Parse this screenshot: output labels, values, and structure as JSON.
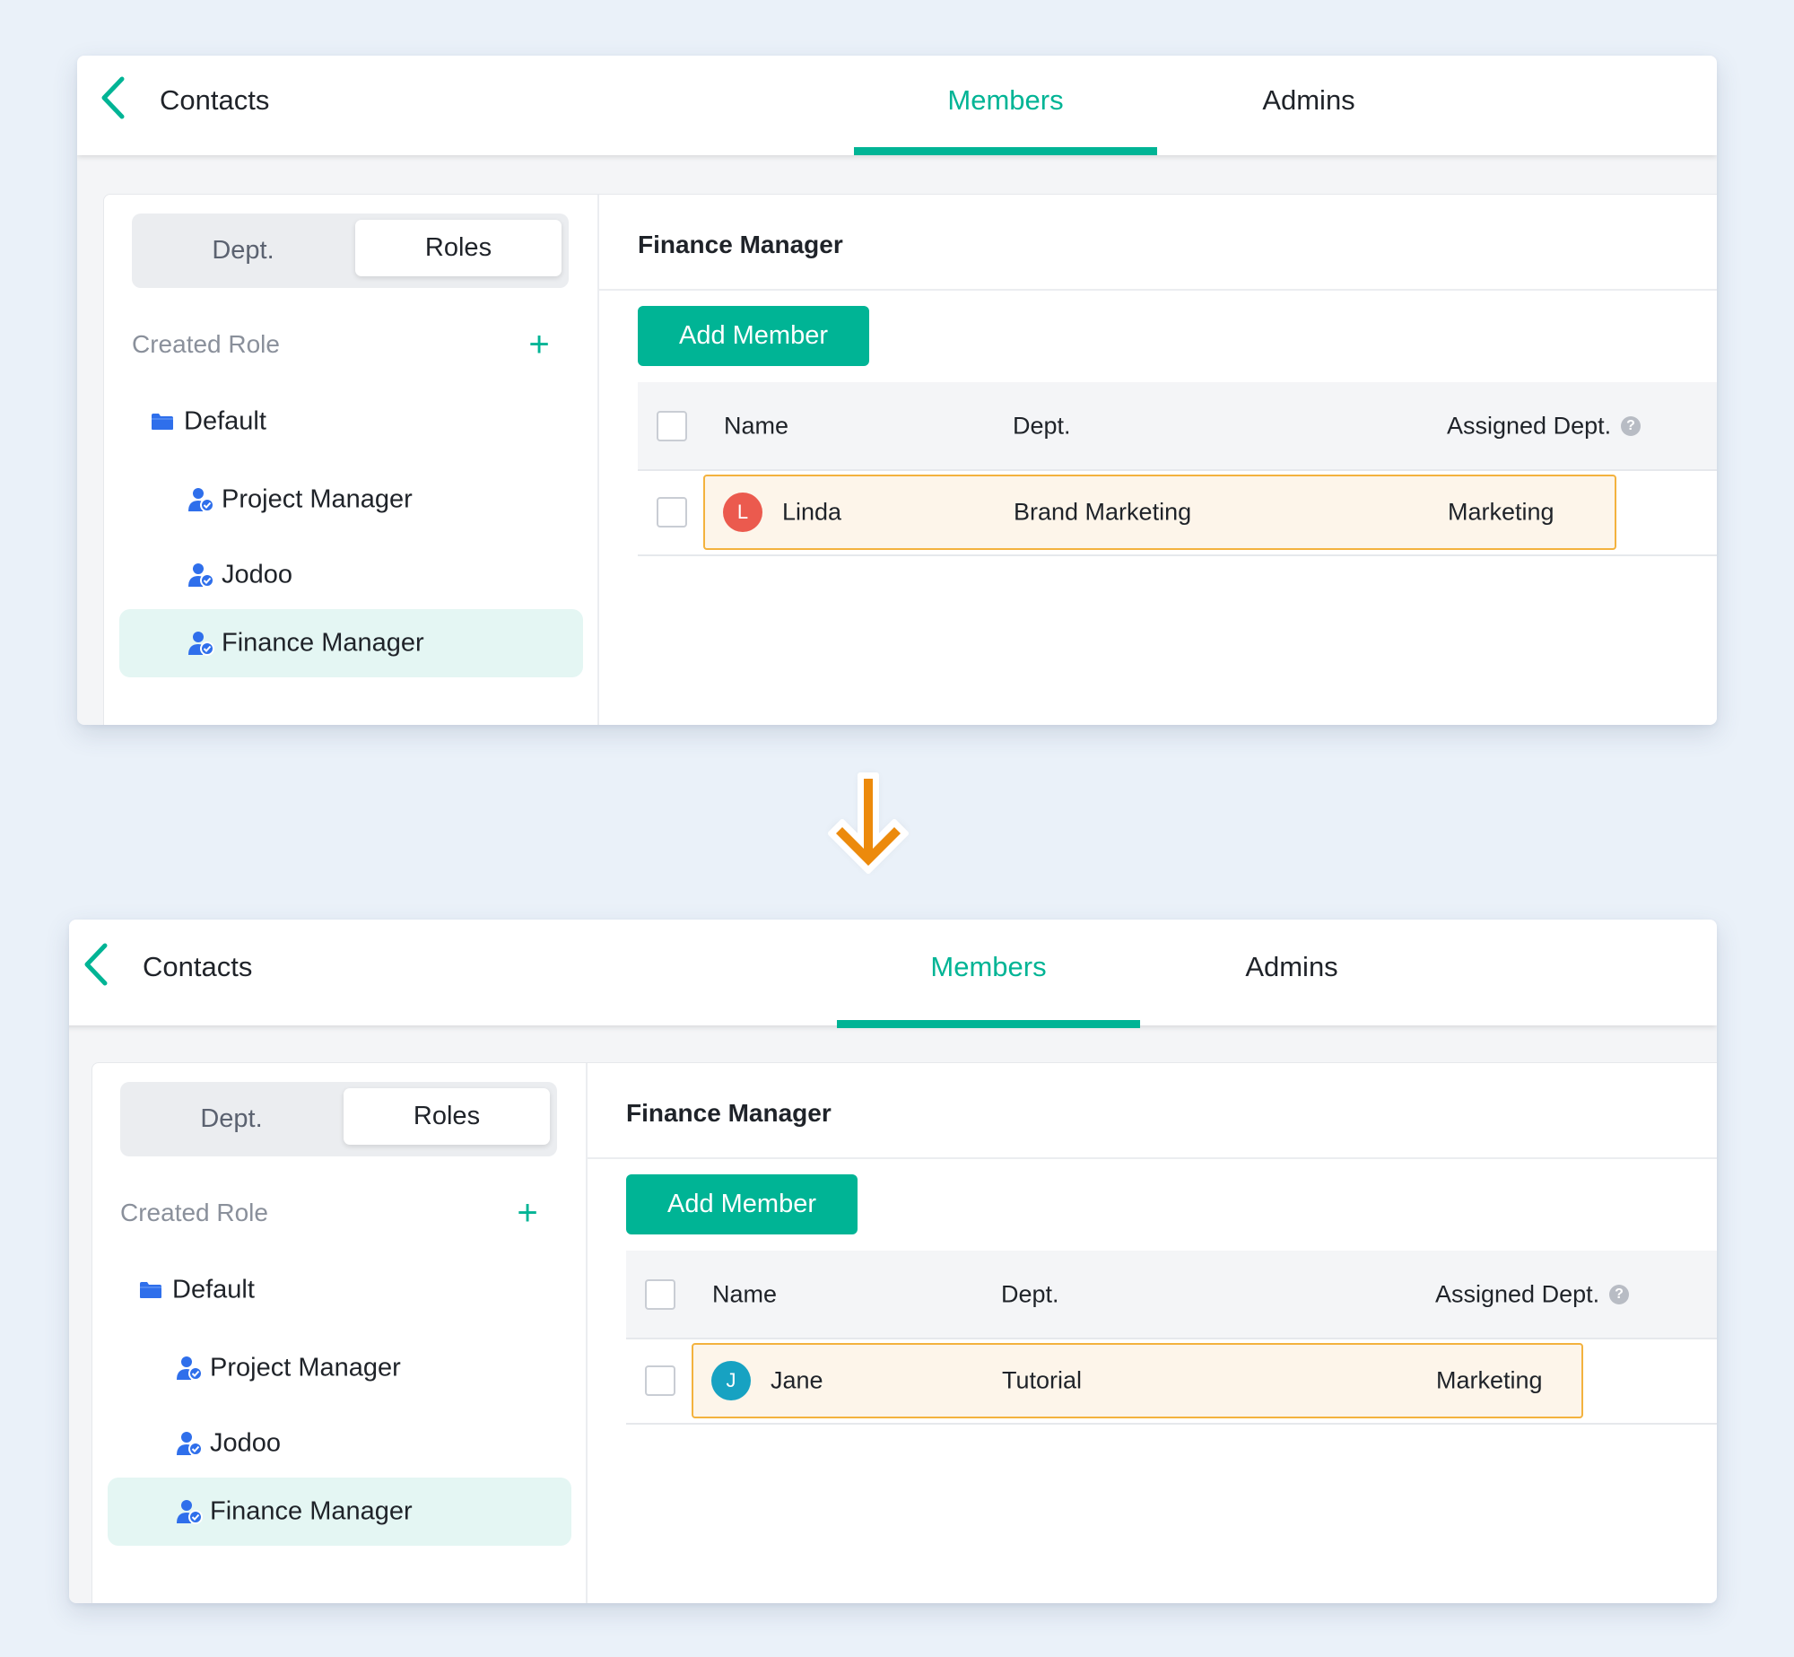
{
  "colors": {
    "accent": "#00B495",
    "highlight_border": "#F3B23E",
    "highlight_bg": "#FDF5EA",
    "arrow": "#EC8A0C",
    "role_icon": "#2F6FEB"
  },
  "arrow_icon": "down-arrow",
  "panels": [
    {
      "header": {
        "back_icon": "chevron-left",
        "title": "Contacts",
        "tabs": [
          {
            "label": "Members",
            "active": true
          },
          {
            "label": "Admins",
            "active": false
          }
        ]
      },
      "sidebar": {
        "segments": [
          {
            "label": "Dept.",
            "active": false
          },
          {
            "label": "Roles",
            "active": true
          }
        ],
        "section_label": "Created Role",
        "add_icon": "plus",
        "folder": {
          "label": "Default",
          "icon": "folder"
        },
        "roles": [
          {
            "label": "Project Manager",
            "icon": "user-check",
            "selected": false
          },
          {
            "label": "Jodoo",
            "icon": "user-check",
            "selected": false
          },
          {
            "label": "Finance Manager",
            "icon": "user-check",
            "selected": true
          }
        ]
      },
      "main": {
        "title": "Finance Manager",
        "add_button": "Add Member",
        "columns": {
          "name": "Name",
          "dept": "Dept.",
          "assigned": "Assigned Dept.",
          "help_icon": "question-circle"
        },
        "rows": [
          {
            "initial": "L",
            "name": "Linda",
            "dept": "Brand Marketing",
            "assigned": "Marketing",
            "avatar_color": "#EB5A4E"
          }
        ]
      }
    },
    {
      "header": {
        "back_icon": "chevron-left",
        "title": "Contacts",
        "tabs": [
          {
            "label": "Members",
            "active": true
          },
          {
            "label": "Admins",
            "active": false
          }
        ]
      },
      "sidebar": {
        "segments": [
          {
            "label": "Dept.",
            "active": false
          },
          {
            "label": "Roles",
            "active": true
          }
        ],
        "section_label": "Created Role",
        "add_icon": "plus",
        "folder": {
          "label": "Default",
          "icon": "folder"
        },
        "roles": [
          {
            "label": "Project Manager",
            "icon": "user-check",
            "selected": false
          },
          {
            "label": "Jodoo",
            "icon": "user-check",
            "selected": false
          },
          {
            "label": "Finance Manager",
            "icon": "user-check",
            "selected": true
          }
        ]
      },
      "main": {
        "title": "Finance Manager",
        "add_button": "Add Member",
        "columns": {
          "name": "Name",
          "dept": "Dept.",
          "assigned": "Assigned Dept.",
          "help_icon": "question-circle"
        },
        "rows": [
          {
            "initial": "J",
            "name": "Jane",
            "dept": "Tutorial",
            "assigned": "Marketing",
            "avatar_color": "#17A2C2"
          }
        ]
      }
    }
  ]
}
